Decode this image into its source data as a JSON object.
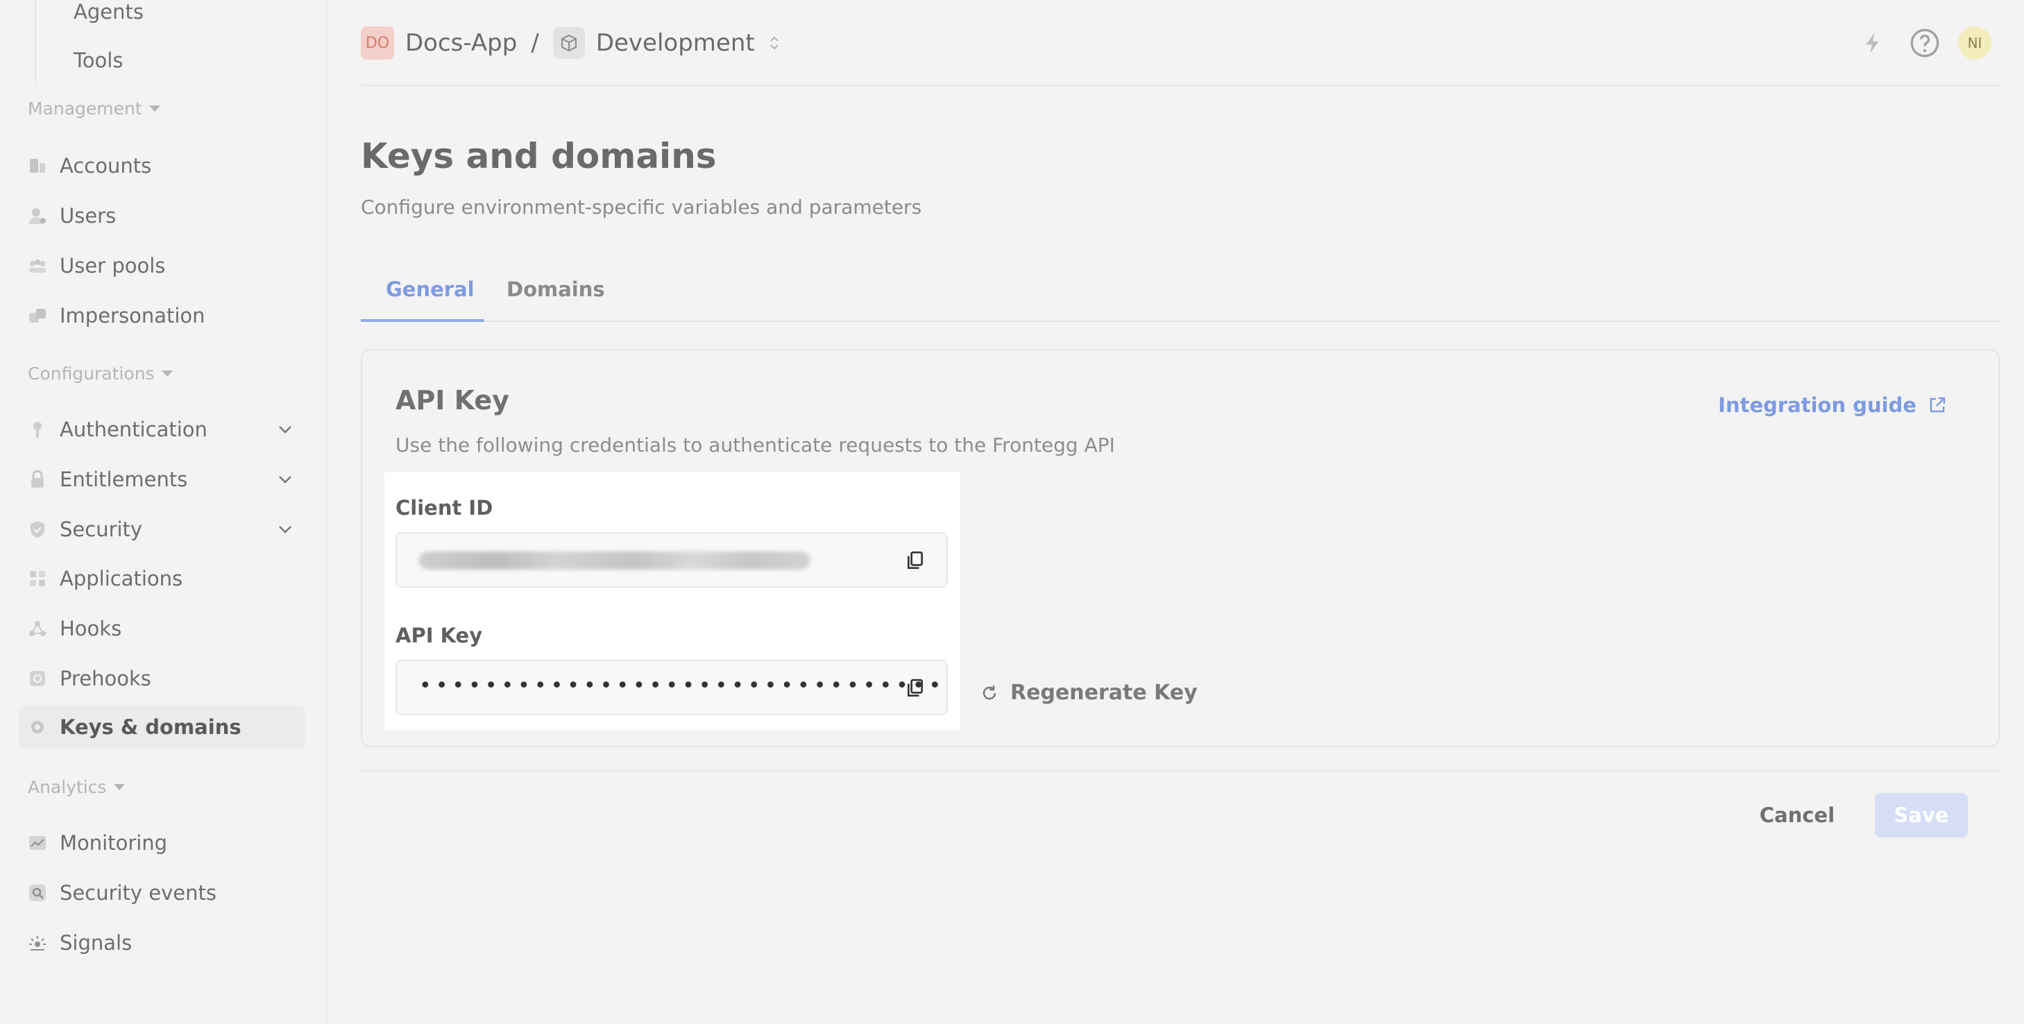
{
  "sidebar": {
    "sub_items": [
      {
        "label": "Agents"
      },
      {
        "label": "Tools"
      }
    ],
    "sections": {
      "management": "Management",
      "configurations": "Configurations",
      "analytics": "Analytics"
    },
    "management_items": [
      {
        "label": "Accounts",
        "icon": "accounts-icon"
      },
      {
        "label": "Users",
        "icon": "users-icon"
      },
      {
        "label": "User pools",
        "icon": "user-pools-icon"
      },
      {
        "label": "Impersonation",
        "icon": "impersonation-icon"
      }
    ],
    "config_items": [
      {
        "label": "Authentication",
        "icon": "key-icon"
      },
      {
        "label": "Entitlements",
        "icon": "lock-icon"
      },
      {
        "label": "Security",
        "icon": "shield-icon"
      },
      {
        "label": "Applications",
        "icon": "grid-icon"
      },
      {
        "label": "Hooks",
        "icon": "hooks-icon"
      },
      {
        "label": "Prehooks",
        "icon": "prehooks-icon"
      },
      {
        "label": "Keys & domains",
        "icon": "gear-icon",
        "active": true
      }
    ],
    "analytics_items": [
      {
        "label": "Monitoring",
        "icon": "chart-icon"
      },
      {
        "label": "Security events",
        "icon": "search-icon"
      },
      {
        "label": "Signals",
        "icon": "signals-icon"
      }
    ]
  },
  "header": {
    "app_badge": "DO",
    "app_name": "Docs-App",
    "separator": "/",
    "environment": "Development",
    "avatar": "NI"
  },
  "page": {
    "title": "Keys and domains",
    "subtitle": "Configure environment-specific variables and parameters"
  },
  "tabs": [
    {
      "label": "General",
      "active": true
    },
    {
      "label": "Domains",
      "active": false
    }
  ],
  "card": {
    "title": "API Key",
    "subtitle": "Use the following credentials to authenticate requests to the Frontegg API",
    "integration_guide": "Integration guide",
    "client_id_label": "Client ID",
    "api_key_label": "API Key",
    "api_key_masked": "••••••••••••••••••••••••••••••••",
    "regenerate_label": "Regenerate Key"
  },
  "footer": {
    "cancel": "Cancel",
    "save": "Save"
  },
  "colors": {
    "accent": "#7d9be0",
    "save_disabled": "#d5def4",
    "background": "#f3f3f3"
  }
}
